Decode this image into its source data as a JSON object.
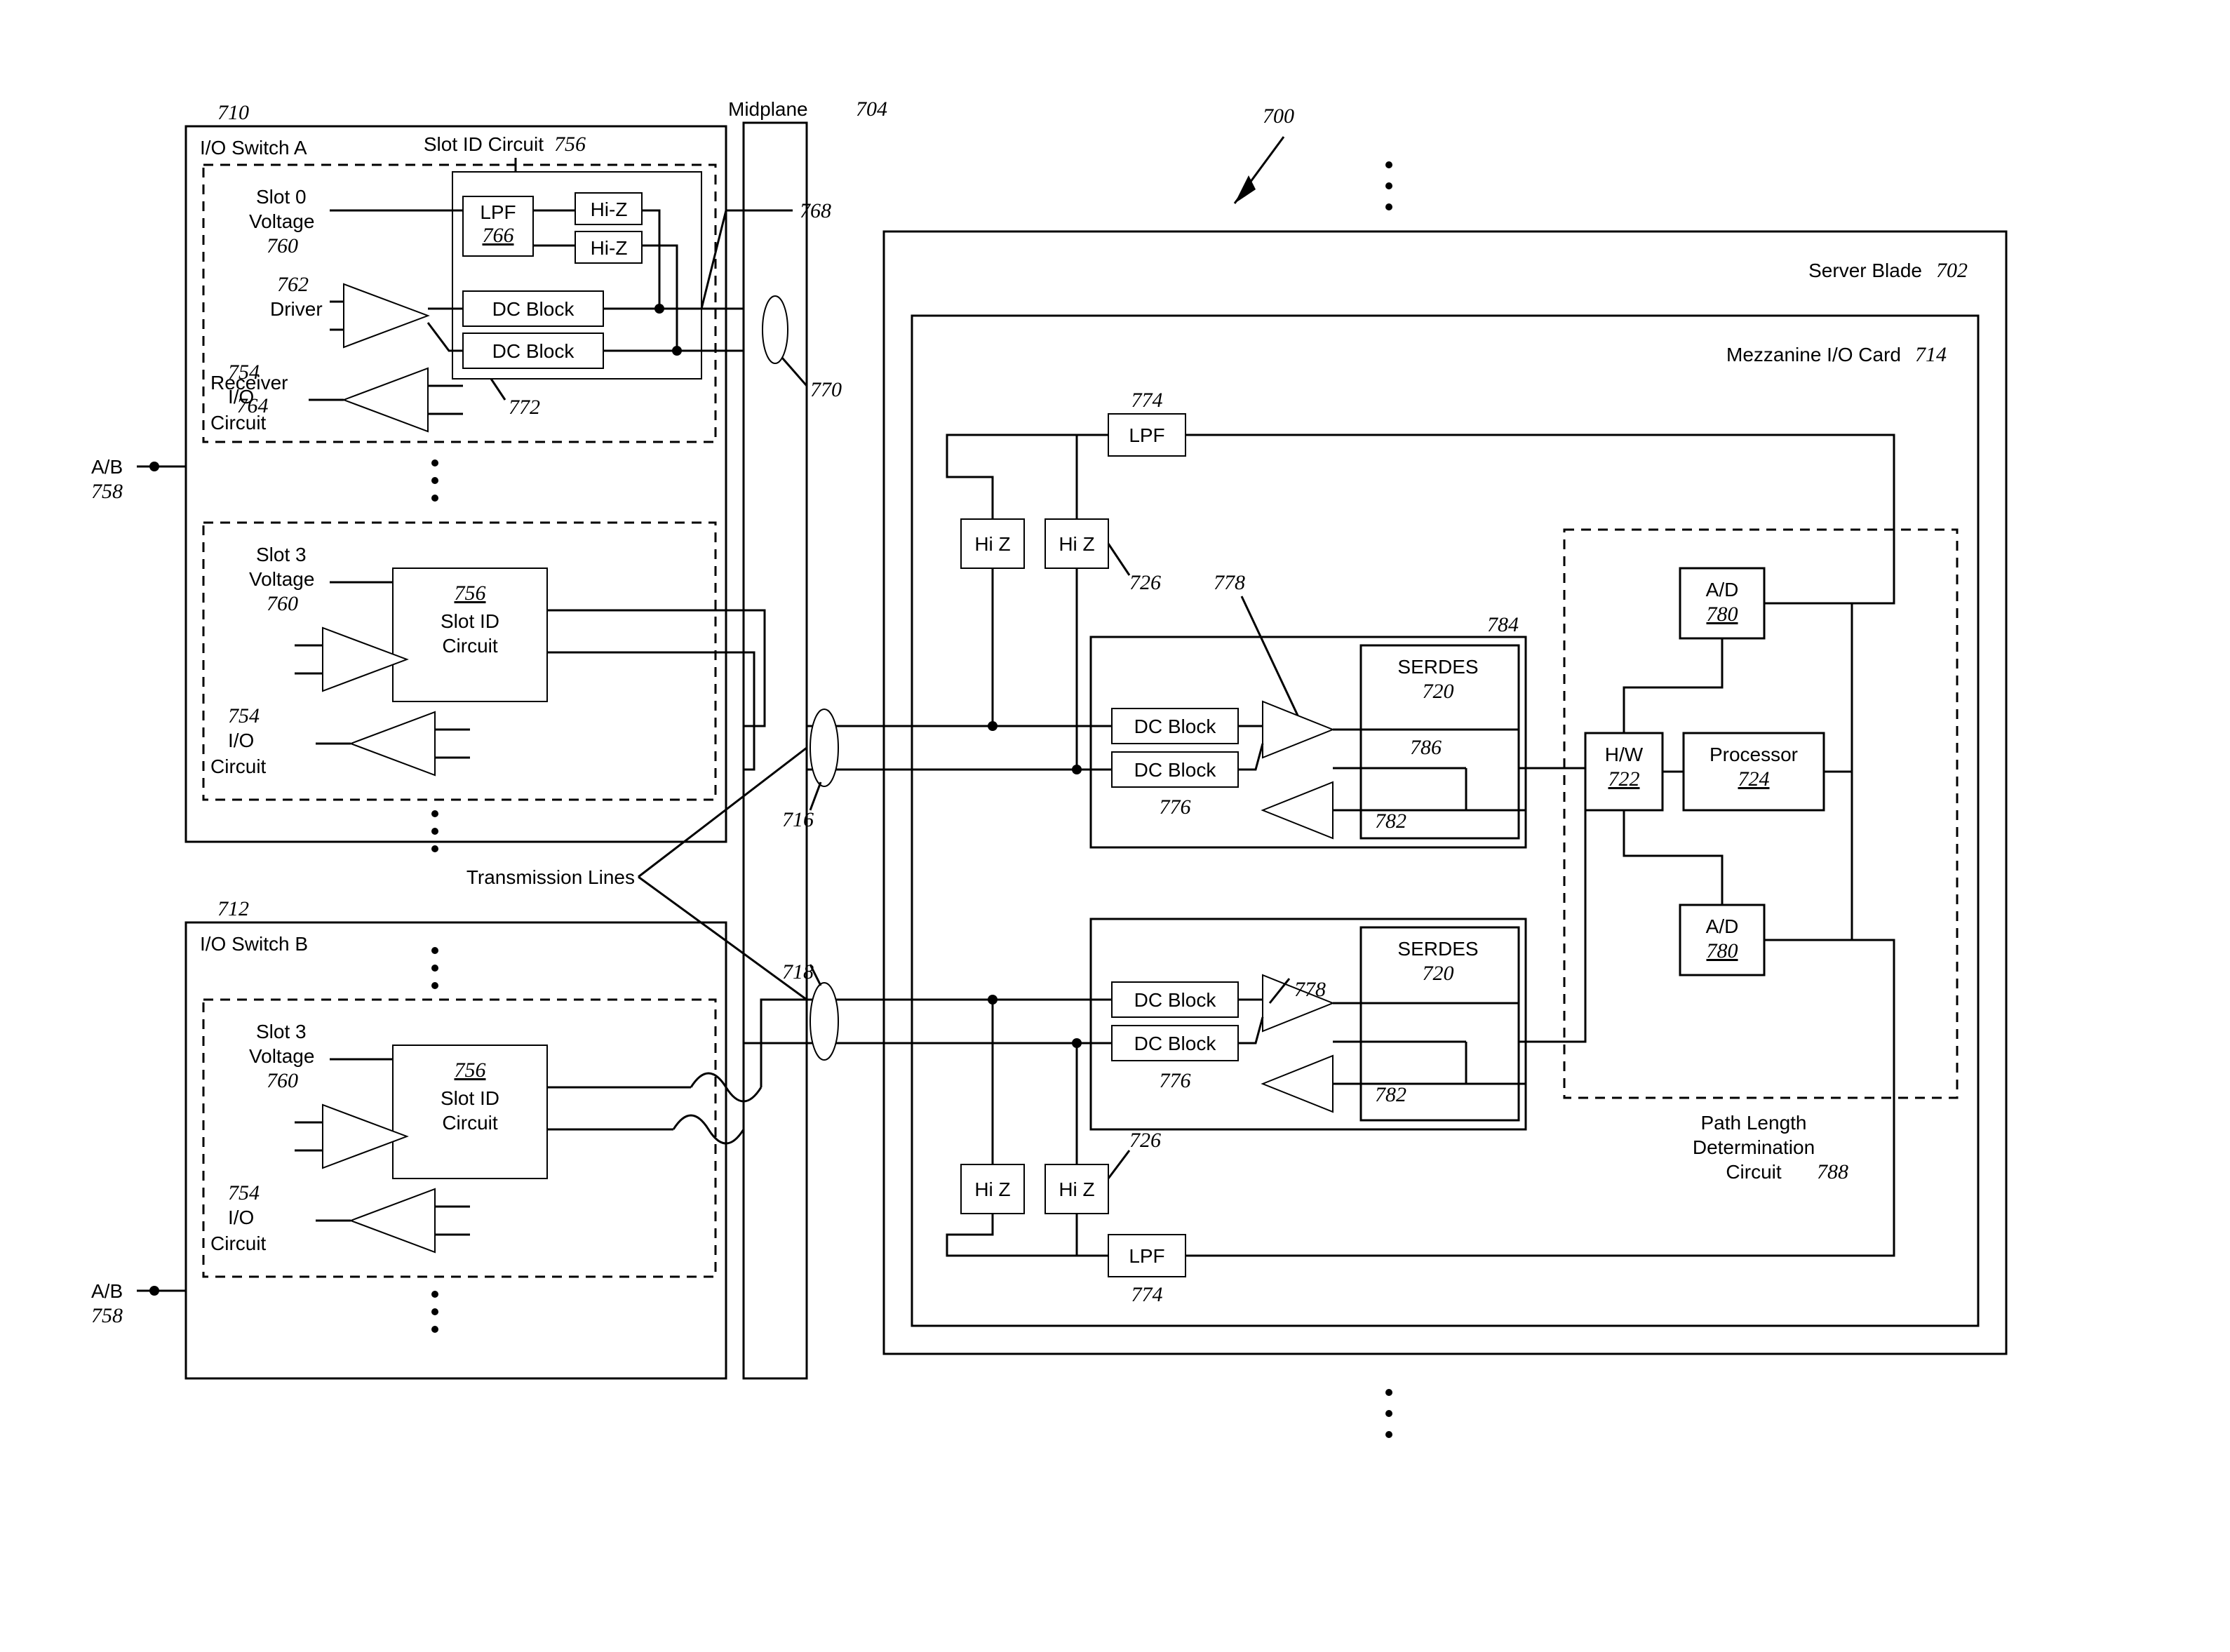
{
  "labels": {
    "system": {
      "text": "700",
      "ref": "700"
    },
    "server_blade": {
      "text": "Server Blade",
      "ref": "702"
    },
    "mezz_card": {
      "text": "Mezzanine I/O Card",
      "ref": "714"
    },
    "midplane": {
      "text": "Midplane",
      "ref": "704"
    },
    "io_switch_a": {
      "text": "I/O Switch A",
      "ref": "710",
      "top": "710"
    },
    "io_switch_b": {
      "text": "I/O Switch B",
      "ref": "712",
      "top": "712"
    },
    "slot_id_circuit": {
      "text": "Slot ID Circuit",
      "ref": "756"
    },
    "slot0_voltage": {
      "text": "Slot 0\nVoltage",
      "ref": "760"
    },
    "slot3_voltage": {
      "text": "Slot 3\nVoltage",
      "ref": "760"
    },
    "driver": {
      "text": "Driver",
      "ref": "762"
    },
    "receiver": {
      "text": "Receiver",
      "ref": "764"
    },
    "io_circuit": {
      "text": "I/O\nCircuit",
      "ref": "754"
    },
    "lpf": {
      "text": "LPF",
      "ref": "766"
    },
    "hiz": {
      "text": "Hi-Z"
    },
    "dcblock": {
      "text": "DC Block",
      "ref": "772"
    },
    "trans_pair_tl": {
      "ref": "768"
    },
    "trans_pair_1": {
      "ref": "770"
    },
    "trans_pair_2": {
      "ref": "716"
    },
    "trans_pair_3": {
      "ref": "718"
    },
    "transmission_lines": {
      "text": "Transmission Lines"
    },
    "ab": {
      "text": "A/B",
      "ref": "758"
    },
    "lpf_r": {
      "text": "LPF",
      "ref": "774"
    },
    "hiz_r": {
      "text": "Hi Z",
      "ref": "726"
    },
    "dcblock_r": {
      "text": "DC Block",
      "ref": "776"
    },
    "serdes": {
      "text": "SERDES",
      "ref": "720"
    },
    "serdes_rx": {
      "ref": "778"
    },
    "serdes_tx": {
      "ref": "782"
    },
    "serdes_sigtop": {
      "ref": "784"
    },
    "serdes_sigbot": {
      "ref": "786"
    },
    "hw": {
      "text": "H/W",
      "ref": "722"
    },
    "processor": {
      "text": "Processor",
      "ref": "724"
    },
    "ad": {
      "text": "A/D",
      "ref": "780"
    },
    "path_len": {
      "text": "Path Length\nDetermination\nCircuit",
      "ref": "788"
    }
  }
}
